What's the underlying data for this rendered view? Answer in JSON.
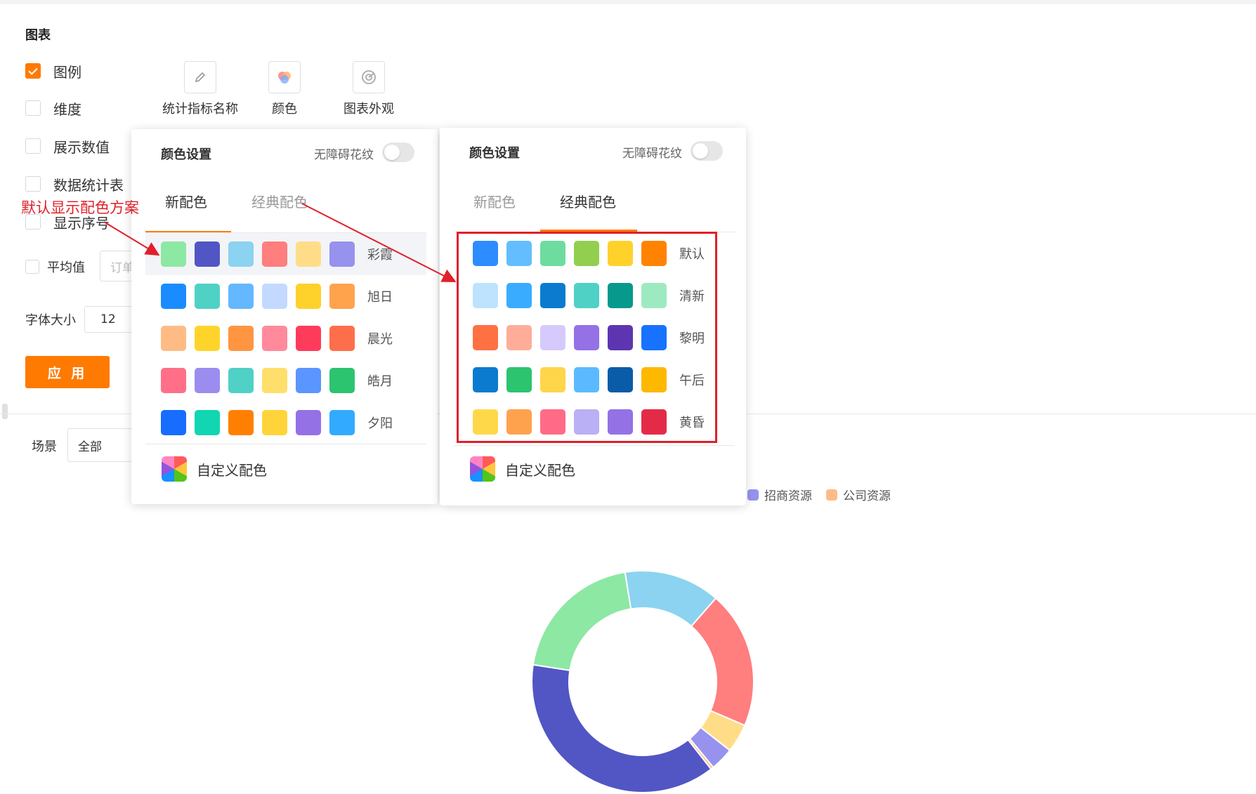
{
  "section_title": "图表",
  "options": [
    {
      "label": "图例",
      "checked": true
    },
    {
      "label": "维度",
      "checked": false
    },
    {
      "label": "展示数值",
      "checked": false
    },
    {
      "label": "数据统计表",
      "checked": false
    },
    {
      "label": "显示序号",
      "checked": false
    }
  ],
  "average": {
    "label": "平均值",
    "placeholder": "订单"
  },
  "font_size": {
    "label": "字体大小",
    "value": "12"
  },
  "apply_label": "应 用",
  "toolbar": {
    "metric_name": "统计指标名称",
    "color": "颜色",
    "appearance": "图表外观"
  },
  "filter": {
    "label": "场景",
    "value": "全部"
  },
  "annotation": "默认显示配色方案",
  "panel_left": {
    "title": "颜色设置",
    "toggle_label": "无障碍花纹",
    "tabs": [
      "新配色",
      "经典配色"
    ],
    "active_tab": "新配色",
    "schemes": [
      {
        "name": "彩霞",
        "colors": [
          "#8de8a4",
          "#5156c4",
          "#8bd3f0",
          "#ff7e7e",
          "#ffdd88",
          "#9692ee"
        ]
      },
      {
        "name": "旭日",
        "colors": [
          "#1a8cff",
          "#4fd1c5",
          "#63b8ff",
          "#c3d9ff",
          "#ffd12b",
          "#ffa34d"
        ]
      },
      {
        "name": "晨光",
        "colors": [
          "#ffbb85",
          "#ffd42a",
          "#ff9540",
          "#ff8a9c",
          "#ff3b5c",
          "#ff6e4a"
        ]
      },
      {
        "name": "皓月",
        "colors": [
          "#ff6f88",
          "#9b8cf0",
          "#4fd1c5",
          "#ffdf6b",
          "#5b95ff",
          "#2cc46f"
        ]
      },
      {
        "name": "夕阳",
        "colors": [
          "#166dff",
          "#11d6b1",
          "#ff8000",
          "#ffd43b",
          "#9571e6",
          "#32aaff"
        ]
      }
    ],
    "custom_label": "自定义配色"
  },
  "panel_right": {
    "title": "颜色设置",
    "toggle_label": "无障碍花纹",
    "tabs": [
      "新配色",
      "经典配色"
    ],
    "active_tab": "经典配色",
    "schemes": [
      {
        "name": "默认",
        "colors": [
          "#2d8cff",
          "#63bdff",
          "#6edc9f",
          "#93cf4f",
          "#ffd12b",
          "#ff8300"
        ]
      },
      {
        "name": "清新",
        "colors": [
          "#bde3ff",
          "#3aacff",
          "#0b7bcf",
          "#4fd1c5",
          "#079a8c",
          "#9eeac0"
        ]
      },
      {
        "name": "黎明",
        "colors": [
          "#ff7043",
          "#ffad99",
          "#d6c9fc",
          "#9571e6",
          "#5e35b1",
          "#1672ff"
        ]
      },
      {
        "name": "午后",
        "colors": [
          "#0b7bcf",
          "#2cc46f",
          "#ffd54a",
          "#5bbaff",
          "#0a5ca8",
          "#ffb800"
        ]
      },
      {
        "name": "黄昏",
        "colors": [
          "#ffd84a",
          "#ffa24e",
          "#ff6b87",
          "#b9b0f5",
          "#9571e6",
          "#e32b48"
        ]
      }
    ],
    "custom_label": "自定义配色"
  },
  "chart_legend": [
    {
      "name": "招商资源",
      "color": "#9692ee"
    },
    {
      "name": "公司资源",
      "color": "#ffbb85"
    }
  ],
  "chart_data": {
    "type": "pie",
    "donut": true,
    "values": [
      38,
      20,
      14,
      20,
      4.2,
      3.4,
      0.4
    ],
    "colors": [
      "#5156c4",
      "#8de8a4",
      "#8bd3f0",
      "#ff7e7e",
      "#ffdd88",
      "#9692ee",
      "#ffbb85"
    ],
    "legend_position": "top"
  }
}
